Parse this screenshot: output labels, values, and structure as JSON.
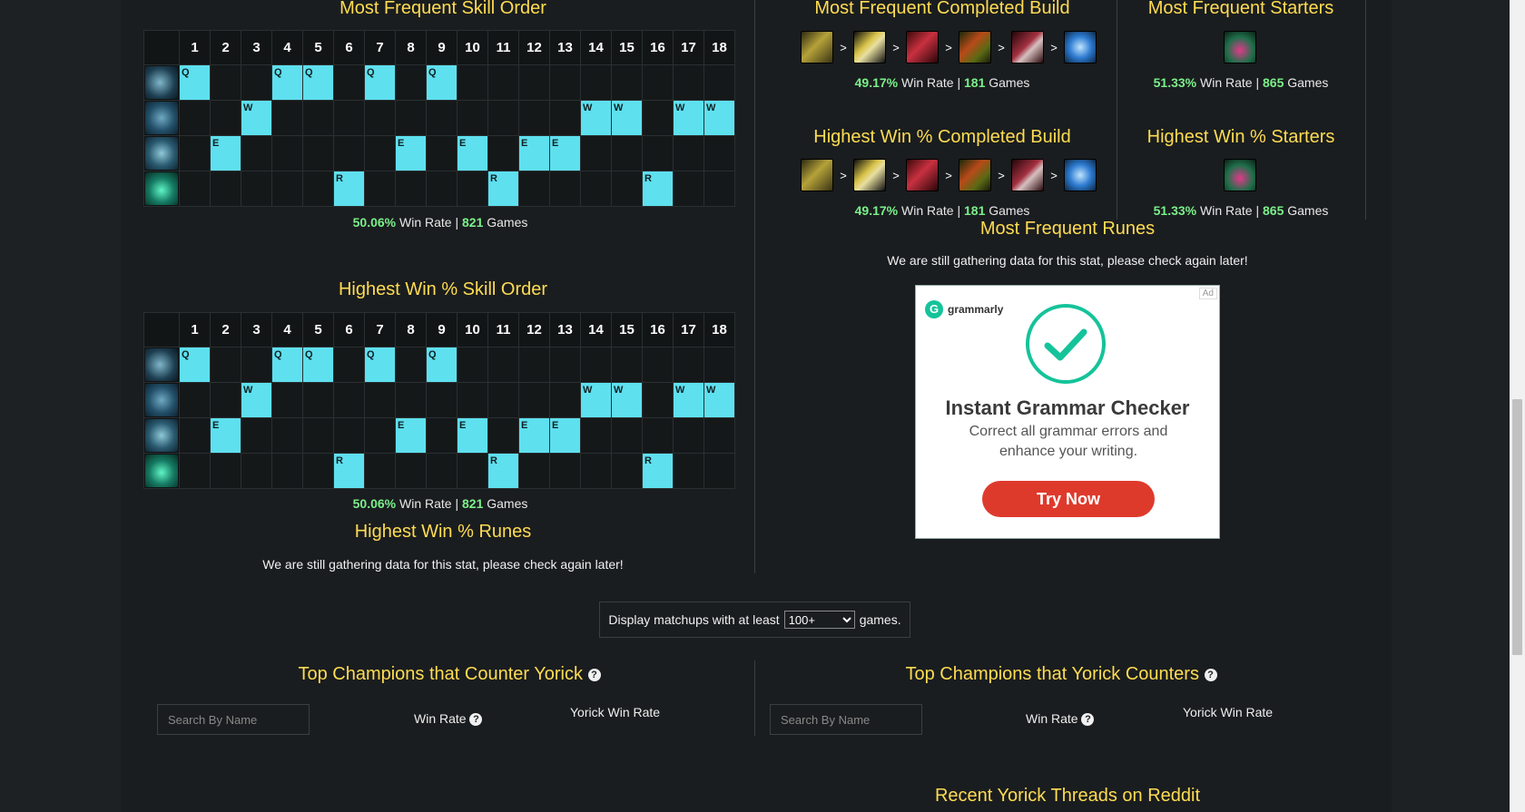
{
  "skill_order_frequent": {
    "title": "Most Frequent Skill Order",
    "levels": [
      "1",
      "2",
      "3",
      "4",
      "5",
      "6",
      "7",
      "8",
      "9",
      "10",
      "11",
      "12",
      "13",
      "14",
      "15",
      "16",
      "17",
      "18"
    ],
    "rows": [
      {
        "ability": "Q",
        "levels": [
          1,
          4,
          5,
          7,
          9
        ]
      },
      {
        "ability": "W",
        "levels": [
          3,
          14,
          15,
          17,
          18
        ]
      },
      {
        "ability": "E",
        "levels": [
          2,
          8,
          10,
          12,
          13
        ]
      },
      {
        "ability": "R",
        "levels": [
          6,
          11,
          16
        ]
      }
    ],
    "win_rate": "50.06%",
    "win_rate_label": "Win Rate |",
    "games": "821",
    "games_label": "Games"
  },
  "skill_order_highest": {
    "title": "Highest Win % Skill Order",
    "levels": [
      "1",
      "2",
      "3",
      "4",
      "5",
      "6",
      "7",
      "8",
      "9",
      "10",
      "11",
      "12",
      "13",
      "14",
      "15",
      "16",
      "17",
      "18"
    ],
    "rows": [
      {
        "ability": "Q",
        "levels": [
          1,
          4,
          5,
          7,
          9
        ]
      },
      {
        "ability": "W",
        "levels": [
          3,
          14,
          15,
          17,
          18
        ]
      },
      {
        "ability": "E",
        "levels": [
          2,
          8,
          10,
          12,
          13
        ]
      },
      {
        "ability": "R",
        "levels": [
          6,
          11,
          16
        ]
      }
    ],
    "win_rate": "50.06%",
    "win_rate_label": "Win Rate |",
    "games": "821",
    "games_label": "Games"
  },
  "highest_runes": {
    "title": "Highest Win % Runes",
    "message": "We are still gathering data for this stat, please check again later!"
  },
  "frequent_build": {
    "title": "Most Frequent Completed Build",
    "items": [
      "boots-icon",
      "trinity-force-icon",
      "bramble-vest-icon",
      "sterak-icon",
      "deaths-dance-icon",
      "frozen-heart-icon"
    ],
    "separator": ">",
    "win_rate": "49.17%",
    "win_rate_label": "Win Rate |",
    "games": "181",
    "games_label": "Games"
  },
  "frequent_starters": {
    "title": "Most Frequent Starters",
    "items": [
      "corrupting-potion-icon"
    ],
    "win_rate": "51.33%",
    "win_rate_label": "Win Rate |",
    "games": "865",
    "games_label": "Games"
  },
  "highest_build": {
    "title": "Highest Win % Completed Build",
    "items": [
      "boots-icon",
      "trinity-force-icon",
      "bramble-vest-icon",
      "sterak-icon",
      "deaths-dance-icon",
      "frozen-heart-icon"
    ],
    "separator": ">",
    "win_rate": "49.17%",
    "win_rate_label": "Win Rate |",
    "games": "181",
    "games_label": "Games"
  },
  "highest_starters": {
    "title": "Highest Win % Starters",
    "items": [
      "corrupting-potion-icon"
    ],
    "win_rate": "51.33%",
    "win_rate_label": "Win Rate |",
    "games": "865",
    "games_label": "Games"
  },
  "frequent_runes": {
    "title": "Most Frequent Runes",
    "message": "We are still gathering data for this stat, please check again later!"
  },
  "ad": {
    "badge": "Ad",
    "brand": "grammarly",
    "brand_initial": "G",
    "headline": "Instant Grammar Checker",
    "body": "Correct all grammar errors and enhance your writing.",
    "cta": "Try Now"
  },
  "matchup_filter": {
    "prefix": "Display matchups with at least",
    "selected": "100+",
    "suffix": "games."
  },
  "counters": {
    "title": "Top Champions that Counter Yorick",
    "search_placeholder": "Search By Name",
    "col_win_rate": "Win Rate",
    "col_yorick_win_rate": "Yorick Win Rate"
  },
  "countered": {
    "title": "Top Champions that Yorick Counters",
    "search_placeholder": "Search By Name",
    "col_win_rate": "Win Rate",
    "col_yorick_win_rate": "Yorick Win Rate"
  },
  "reddit": {
    "title": "Recent Yorick Threads on Reddit"
  },
  "colors": {
    "accent_title": "#ffdc52",
    "skill_cell": "#5ee0ef",
    "stat_green": "#7bf08a",
    "background": "#1a1d1f"
  }
}
